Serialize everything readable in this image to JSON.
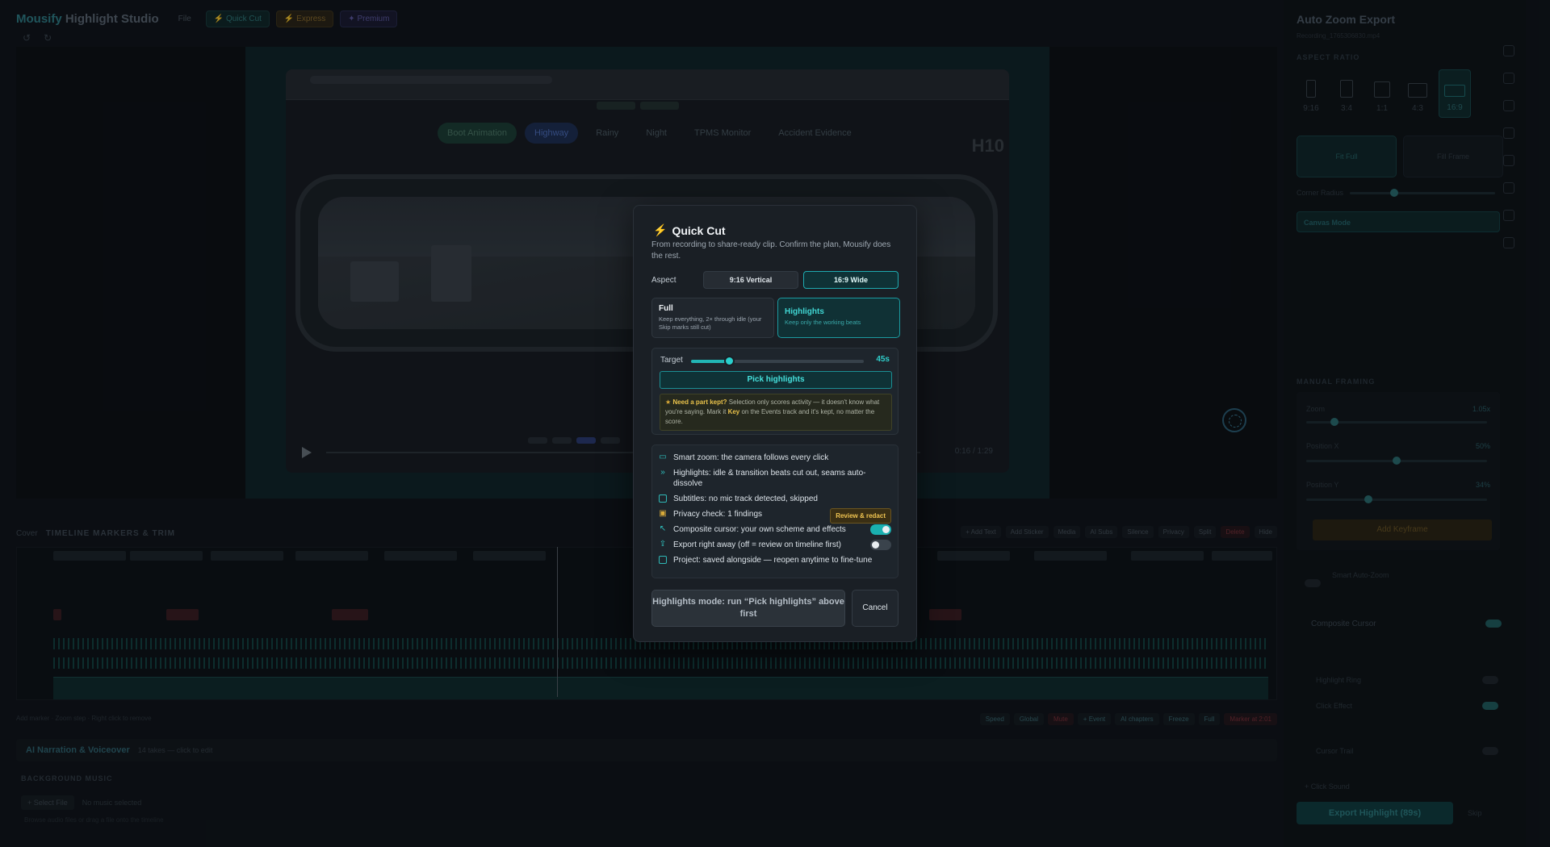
{
  "app": {
    "brand_a": "Mousify",
    "brand_b": "Highlight Studio",
    "menu": {
      "file": "File",
      "quick_cut": "⚡ Quick Cut",
      "express": "⚡ Express",
      "premium": "✦ Premium"
    }
  },
  "preview": {
    "tabs": [
      "Boot Animation",
      "Highway",
      "Rainy",
      "Night",
      "TPMS Monitor",
      "Accident Evidence"
    ],
    "badge": "H10",
    "time": "0:16 / 1:29"
  },
  "timeline": {
    "cover": "Cover",
    "title": "TIMELINE MARKERS & TRIM",
    "tools": [
      "+ Add Text",
      "Add Sticker",
      "Media",
      "AI Subs",
      "Silence",
      "Privacy",
      "Split",
      "Delete",
      "Hide"
    ],
    "foot_hint": "Add marker · Zoom step · Right click to remove",
    "chips": [
      "Speed",
      "Global",
      "Mute",
      "+ Event",
      "AI chapters",
      "Freeze",
      "Full",
      "Marker at 2:01"
    ]
  },
  "narration": {
    "title": "AI Narration & Voiceover",
    "sub": "14 takes — click to edit"
  },
  "bgm": {
    "title": "BACKGROUND MUSIC",
    "select": "+ Select File",
    "none": "No music selected",
    "hint": "Browse audio files or drag a file onto the timeline"
  },
  "right_panel": {
    "title": "Auto Zoom Export",
    "sub": "Recording_1765306830.mp4",
    "aspect_section": "ASPECT RATIO",
    "aspects": [
      "9:16",
      "3:4",
      "1:1",
      "4:3",
      "16:9"
    ],
    "fit_a": "Fit Full",
    "fit_b": "Fill Frame",
    "corner": "Corner Radius",
    "canvas_mode": "Canvas Mode",
    "manual": "MANUAL FRAMING",
    "zoom": "Zoom",
    "zoom_val": "1.05x",
    "posx": "Position X",
    "posx_val": "50%",
    "posy": "Position Y",
    "posy_val": "34%",
    "add_keyframe": "Add Keyframe",
    "smart_auto": "Smart Auto-Zoom",
    "composite": "Composite Cursor",
    "highlight_ring": "Highlight Ring",
    "click_effect": "Click Effect",
    "cursor_trail": "Cursor Trail",
    "click_sound": "+ Click Sound",
    "export": "Export Highlight (89s)",
    "skip": "Skip"
  },
  "modal": {
    "title": "Quick Cut",
    "desc": "From recording to share-ready clip. Confirm the plan, Mousify does the rest.",
    "aspect_label": "Aspect",
    "aspect_vertical": "9:16 Vertical",
    "aspect_wide": "16:9 Wide",
    "full_title": "Full",
    "full_desc": "Keep everything, 2× through idle (your Skip marks still cut)",
    "hl_title": "Highlights",
    "hl_desc": "Keep only the working beats",
    "target_label": "Target",
    "target_value": "45s",
    "target_fraction": 0.22,
    "pick_btn": "Pick highlights",
    "tip_bold": "Need a part kept?",
    "tip_text": " Selection only scores activity — it doesn't know what you're saying. Mark it ",
    "tip_key": "Key",
    "tip_tail": " on the Events track and it's kept, no matter the score.",
    "items": {
      "smart_zoom": "Smart zoom: the camera follows every click",
      "highlights": "Highlights: idle & transition beats cut out, seams auto-dissolve",
      "subtitles": "Subtitles: no mic track detected, skipped",
      "privacy": "Privacy check: 1 findings",
      "review": "Review & redact",
      "cursor": "Composite cursor: your own scheme and effects",
      "export": "Export right away (off = review on timeline first)",
      "project": "Project: saved alongside — reopen anytime to fine-tune"
    },
    "run_btn": "Highlights mode: run “Pick highlights” above first",
    "cancel": "Cancel"
  }
}
